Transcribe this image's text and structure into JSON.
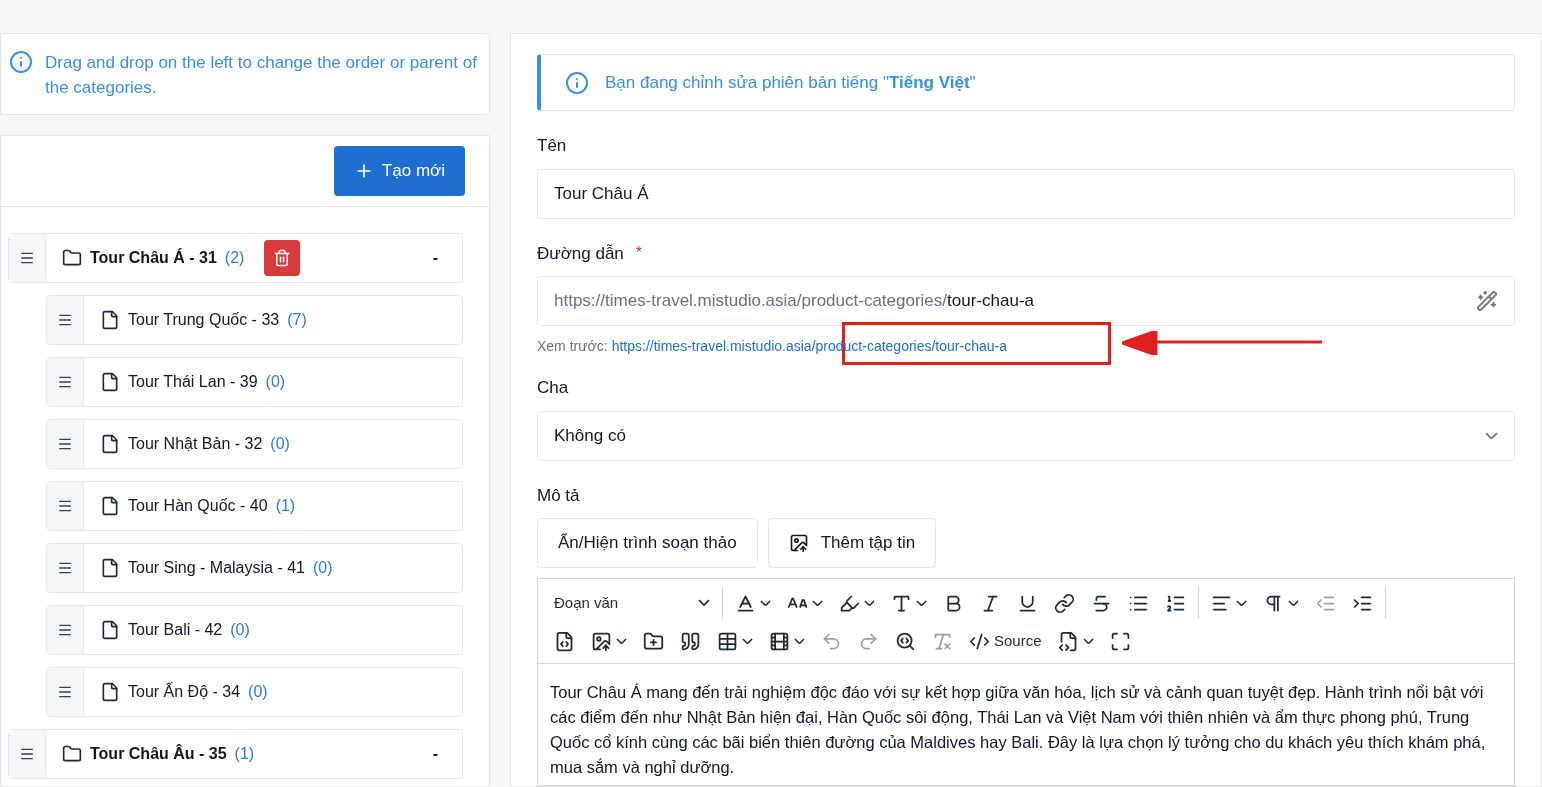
{
  "left_notice": {
    "text": "Drag and drop on the left to change the order or parent of the categories."
  },
  "create_button": {
    "label": "Tạo mới"
  },
  "tree": [
    {
      "kind": "folder",
      "label": "Tour Châu Á - 31",
      "count": "(2)",
      "selected": true,
      "toggle": "-",
      "children": [
        {
          "kind": "file",
          "label": "Tour Trung Quốc - 33",
          "count": "(7)",
          "selected": false
        },
        {
          "kind": "file",
          "label": "Tour Thái Lan - 39",
          "count": "(0)",
          "selected": false
        },
        {
          "kind": "file",
          "label": "Tour Nhật Bản - 32",
          "count": "(0)",
          "selected": false
        },
        {
          "kind": "file",
          "label": "Tour Hàn Quốc - 40",
          "count": "(1)",
          "selected": false
        },
        {
          "kind": "file",
          "label": "Tour Sing - Malaysia - 41",
          "count": "(0)",
          "selected": false
        },
        {
          "kind": "file",
          "label": "Tour Bali - 42",
          "count": "(0)",
          "selected": false
        },
        {
          "kind": "file",
          "label": "Tour Ấn Độ - 34",
          "count": "(0)",
          "selected": false
        }
      ]
    },
    {
      "kind": "folder",
      "label": "Tour Châu Âu - 35",
      "count": "(1)",
      "selected": false,
      "toggle": "-"
    }
  ],
  "language_notice": {
    "text": "Bạn đang chỉnh sửa phiên bản tiếng \"**Tiếng Việt**\""
  },
  "name_field": {
    "label": "Tên",
    "value": "Tour Châu Á"
  },
  "path_field": {
    "label": "Đường dẫn",
    "required_mark": "*",
    "prefix": "https://times-travel.mistudio.asia/product-categories/",
    "value": "tour-chau-a",
    "preview_label": "Xem trước:",
    "preview_link": "https://times-travel.mistudio.asia/product-categories/tour-chau-a"
  },
  "parent_field": {
    "label": "Cha",
    "value": "Không có"
  },
  "description": {
    "label": "Mô tả",
    "buttons": [
      {
        "kind": "toggle",
        "label": "Ẩn/Hiện trình soạn thảo"
      },
      {
        "kind": "file",
        "label": "Thêm tập tin"
      }
    ],
    "format": "Đoạn văn",
    "toolbar_row_1": [
      {
        "kind": "font-color",
        "dropdown": true,
        "disabled": false
      },
      {
        "kind": "font-size",
        "dropdown": true,
        "disabled": false
      },
      {
        "kind": "highlight",
        "dropdown": true,
        "disabled": false
      },
      {
        "kind": "font-style",
        "dropdown": true,
        "disabled": false
      },
      {
        "kind": "bold",
        "dropdown": false,
        "disabled": false
      },
      {
        "kind": "italic",
        "dropdown": false,
        "disabled": false
      },
      {
        "kind": "underline",
        "dropdown": false,
        "disabled": false
      },
      {
        "kind": "link",
        "dropdown": false,
        "disabled": false
      },
      {
        "kind": "strike",
        "dropdown": false,
        "disabled": false
      },
      {
        "kind": "bullets",
        "dropdown": false,
        "disabled": false
      },
      {
        "kind": "numbers",
        "dropdown": false,
        "disabled": false
      },
      {
        "kind": "separator"
      },
      {
        "kind": "align",
        "dropdown": true,
        "disabled": false
      },
      {
        "kind": "direction",
        "dropdown": true,
        "disabled": false
      },
      {
        "kind": "outdent",
        "dropdown": false,
        "disabled": true
      },
      {
        "kind": "indent",
        "dropdown": false,
        "disabled": false
      },
      {
        "kind": "separator"
      }
    ],
    "toolbar_row_2": [
      {
        "kind": "html",
        "dropdown": false,
        "disabled": false
      },
      {
        "kind": "image",
        "dropdown": true,
        "disabled": false
      },
      {
        "kind": "folder",
        "dropdown": false,
        "disabled": false
      },
      {
        "kind": "quote",
        "dropdown": false,
        "disabled": false
      },
      {
        "kind": "table",
        "dropdown": true,
        "disabled": false
      },
      {
        "kind": "media",
        "dropdown": true,
        "disabled": false
      },
      {
        "kind": "undo",
        "dropdown": false,
        "disabled": true
      },
      {
        "kind": "redo",
        "dropdown": false,
        "disabled": true
      },
      {
        "kind": "find",
        "dropdown": false,
        "disabled": false
      },
      {
        "kind": "clear-format",
        "dropdown": false,
        "disabled": true
      },
      {
        "kind": "source",
        "label": "Source",
        "dropdown": false,
        "disabled": false
      },
      {
        "kind": "code",
        "dropdown": true,
        "disabled": false
      },
      {
        "kind": "fullscreen",
        "dropdown": false,
        "disabled": false
      }
    ],
    "body": "Tour Châu Á mang đến trải nghiệm độc đáo với sự kết hợp giữa văn hóa, lịch sử và cảnh quan tuyệt đẹp. Hành trình nổi bật với các điểm đến như Nhật Bản hiện đại, Hàn Quốc sôi động, Thái Lan và Việt Nam với thiên nhiên và ẩm thực phong phú, Trung Quốc cổ kính cùng các bãi biển thiên đường của Maldives hay Bali. Đây là lựa chọn lý tưởng cho du khách yêu thích khám phá, mua sắm và nghỉ dưỡng."
  }
}
